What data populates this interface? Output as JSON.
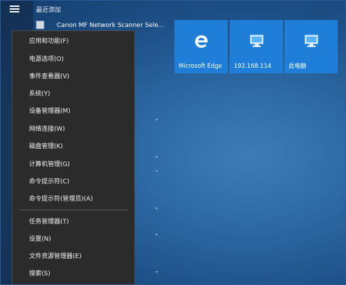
{
  "start_menu": {
    "recent_header": "最近添加",
    "recent_app": "Canon MF Network Scanner Sele..."
  },
  "tiles": [
    {
      "label": "Microsoft Edge",
      "icon": "edge-icon"
    },
    {
      "label": "192.168.114",
      "icon": "computer-icon"
    },
    {
      "label": "此电脑",
      "icon": "computer-icon"
    }
  ],
  "context_menu": {
    "group1": [
      "应用和功能(F)",
      "电源选项(O)",
      "事件查看器(V)",
      "系统(Y)",
      "设备管理器(M)",
      "网络连接(W)",
      "磁盘管理(K)",
      "计算机管理(G)",
      "命令提示符(C)",
      "命令提示符(管理员)(A)"
    ],
    "group2": [
      "任务管理器(T)",
      "设置(N)",
      "文件资源管理器(E)",
      "搜索(S)"
    ]
  },
  "colors": {
    "tile": "#1f7fd8",
    "menu_bg": "#2b2b2b",
    "desktop": "#1d4f86"
  }
}
